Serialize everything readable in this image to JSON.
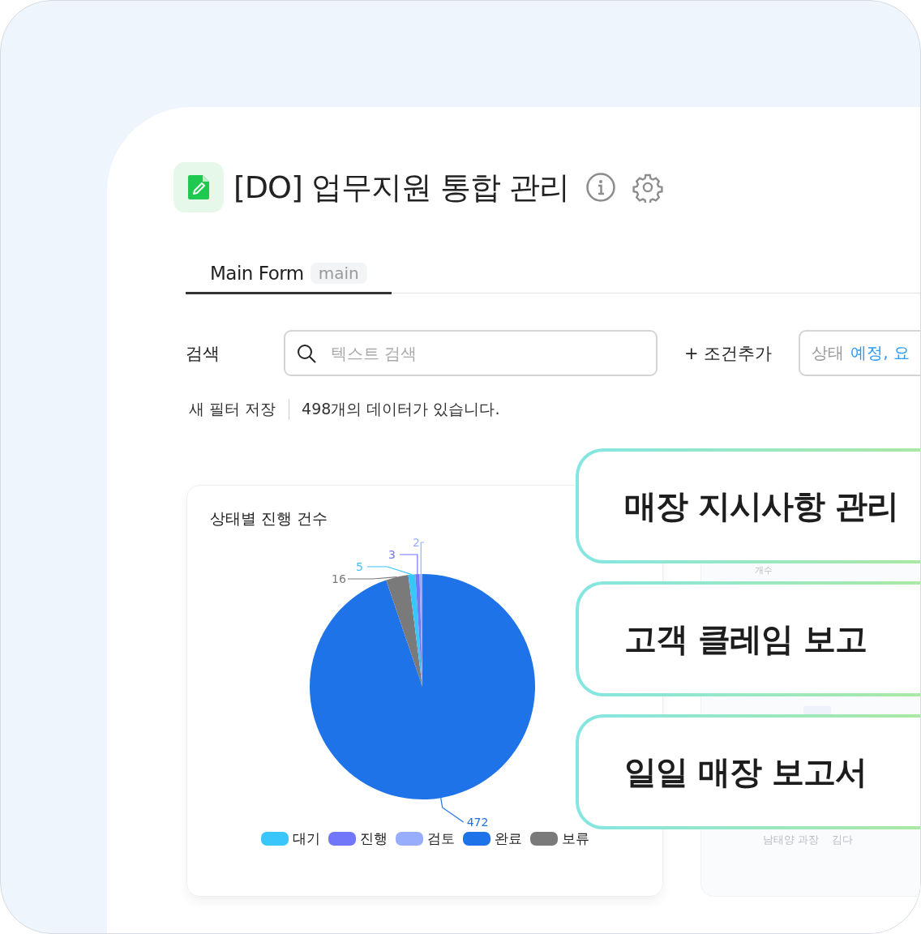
{
  "header": {
    "title": "[DO] 업무지원 통합 관리"
  },
  "tabs": [
    {
      "label": "Main Form",
      "badge": "main",
      "selected": true
    }
  ],
  "search": {
    "label": "검색",
    "placeholder": "텍스트 검색",
    "add_condition": "+ 조건추가",
    "filter_chip": {
      "name": "상태",
      "value": "예정, 요"
    }
  },
  "filter_bar": {
    "save": "새 필터 저장",
    "count": "498개의 데이터가 있습니다."
  },
  "status_chart": {
    "title": "상태별 진행 건수",
    "chart_data": {
      "type": "pie",
      "categories": [
        "대기",
        "진행",
        "검토",
        "완료",
        "보류"
      ],
      "data_labels": true,
      "series": [
        {
          "values": [
            5,
            3,
            2,
            472,
            16
          ]
        }
      ],
      "colors": [
        "#38c6fb",
        "#7177f8",
        "#98aefc",
        "#1f73e8",
        "#7a7a7a"
      ]
    }
  },
  "faded_card": {
    "axis_label": "개수",
    "row_labels": [
      "남태양 과장",
      "김다"
    ]
  },
  "overlay_cards": [
    {
      "label": "매장 지시사항 관리"
    },
    {
      "label": "고객 클레임 보고"
    },
    {
      "label": "일일 매장 보고서"
    }
  ]
}
